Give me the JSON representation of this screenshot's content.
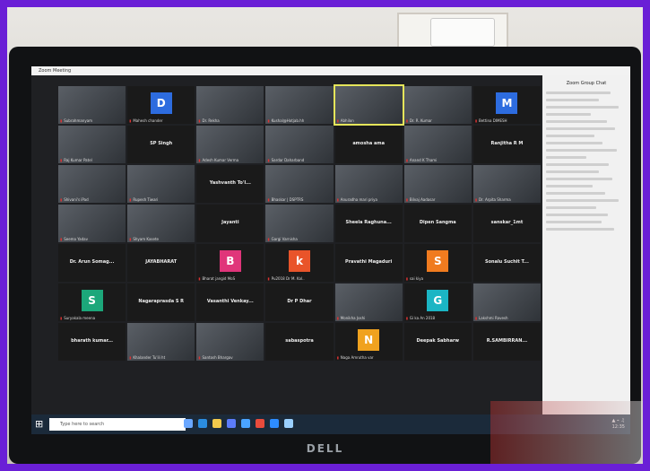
{
  "window": {
    "title": "Zoom Meeting"
  },
  "taskbar": {
    "search_placeholder": "Type here to search"
  },
  "chat": {
    "title": "Zoom Group Chat"
  },
  "monitor": {
    "brand": "DELL"
  },
  "grid": [
    {
      "name": "Subrahmanyam",
      "type": "video"
    },
    {
      "name": "Mahesh chander",
      "type": "avatar",
      "letter": "D",
      "color": "#2d6cdf"
    },
    {
      "name": "Dr. Rekha",
      "type": "video"
    },
    {
      "name": "Kushal@Hotjab.hh",
      "type": "video"
    },
    {
      "name": "Abhilon",
      "type": "video",
      "active": true
    },
    {
      "name": "Dr. R. Kumar",
      "type": "video"
    },
    {
      "name": "Bettina DIMESH",
      "type": "avatar",
      "letter": "M",
      "color": "#2d6cdf"
    },
    {
      "name": "Raj Kumar Patel",
      "type": "video"
    },
    {
      "name": "",
      "type": "text",
      "label": "SP Singh"
    },
    {
      "name": "Adesh Kumar Verma",
      "type": "video"
    },
    {
      "name": "Sardar Daharband",
      "type": "video"
    },
    {
      "name": "",
      "type": "text",
      "label": "amosha ama"
    },
    {
      "name": "Anand K Thami",
      "type": "video"
    },
    {
      "name": "",
      "type": "text",
      "label": "Ranjitha R M"
    },
    {
      "name": "Shivani's iPad",
      "type": "video"
    },
    {
      "name": "Rupesh Tiwari",
      "type": "video"
    },
    {
      "name": "",
      "type": "text",
      "label": "Yashvanth To'I..."
    },
    {
      "name": "Bhaskar | DSPTRS",
      "type": "video"
    },
    {
      "name": "Anuradha mari priya",
      "type": "video"
    },
    {
      "name": "Bilvaj Aadasar",
      "type": "video"
    },
    {
      "name": "Dr. Arpita Sharma",
      "type": "video"
    },
    {
      "name": "Seema Yadav",
      "type": "video"
    },
    {
      "name": "Shyam Kasete",
      "type": "video"
    },
    {
      "name": "",
      "type": "text",
      "label": "Jayanti"
    },
    {
      "name": "Gargi Varnisha",
      "type": "video"
    },
    {
      "name": "",
      "type": "text",
      "label": "Sheela Raghuna..."
    },
    {
      "name": "",
      "type": "text",
      "label": "Dipen Sangma"
    },
    {
      "name": "",
      "type": "text",
      "label": "sanskar_1mt"
    },
    {
      "name": "",
      "type": "text",
      "label": "Dr. Arun Somag..."
    },
    {
      "name": "",
      "type": "text",
      "label": "JAYABHARAT"
    },
    {
      "name": "Bharat jangid MoS",
      "type": "avatar",
      "letter": "B",
      "color": "#e0357a"
    },
    {
      "name": "Pu2018 Dr M. Kal..",
      "type": "avatar",
      "letter": "k",
      "color": "#e9542a"
    },
    {
      "name": "",
      "type": "text",
      "label": "Pravathi Magaduri"
    },
    {
      "name": "sai kiya",
      "type": "avatar",
      "letter": "S",
      "color": "#f07b1f"
    },
    {
      "name": "",
      "type": "text",
      "label": "Sonalu Suchit T..."
    },
    {
      "name": "Suryakala meena",
      "type": "avatar",
      "letter": "S",
      "color": "#1ca77a"
    },
    {
      "name": "",
      "type": "text",
      "label": "Nagaraprasda S R"
    },
    {
      "name": "",
      "type": "text",
      "label": "Vasanthi Venkay..."
    },
    {
      "name": "",
      "type": "text",
      "label": "Dr P Dhar"
    },
    {
      "name": "Monikha Joshi",
      "type": "video"
    },
    {
      "name": "Gi ka An 2018",
      "type": "avatar",
      "letter": "G",
      "color": "#1bb5c4"
    },
    {
      "name": "Lakshmi Ravesh",
      "type": "video"
    },
    {
      "name": "",
      "type": "text",
      "label": "bharath kumar..."
    },
    {
      "name": "Khalander Tu'ili ht",
      "type": "video"
    },
    {
      "name": "Santosh Bhargav",
      "type": "video"
    },
    {
      "name": "",
      "type": "text",
      "label": "sabaspotra"
    },
    {
      "name": "Naga Amrutha var",
      "type": "avatar",
      "letter": "N",
      "color": "#f0a21f"
    },
    {
      "name": "",
      "type": "text",
      "label": "Deepak Sabharw"
    },
    {
      "name": "",
      "type": "text",
      "label": "R.SAMBIRRAN..."
    }
  ]
}
